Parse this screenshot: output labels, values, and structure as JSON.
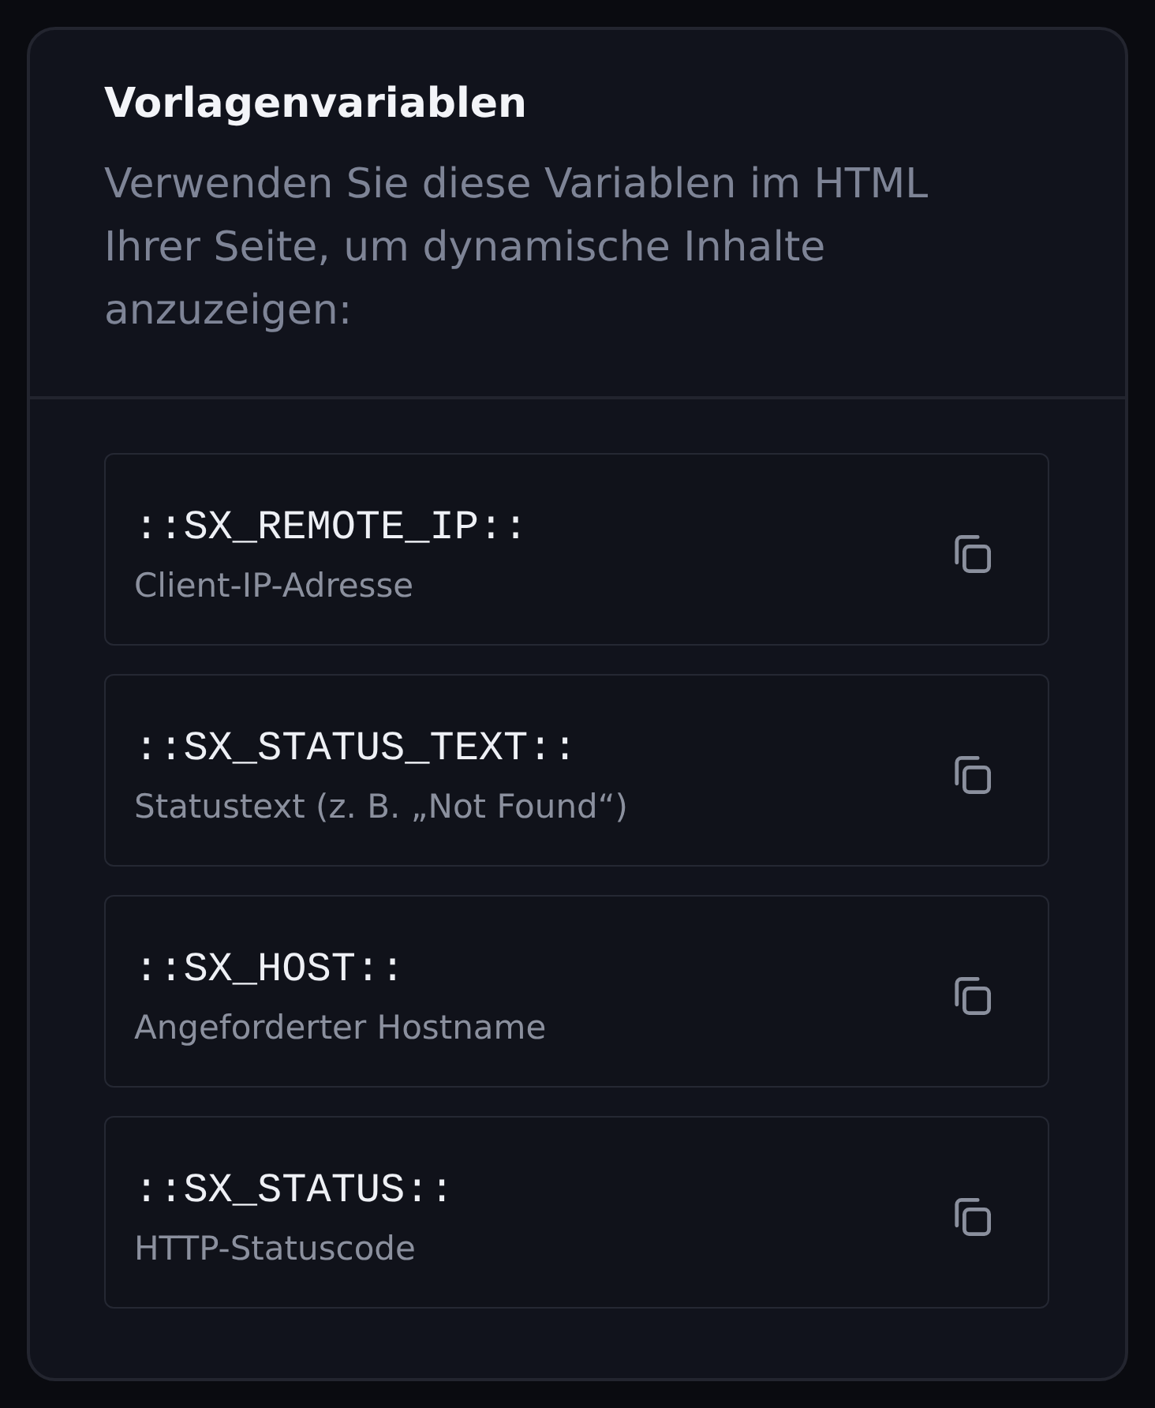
{
  "panel": {
    "title": "Vorlagenvariablen",
    "description": "Verwenden Sie diese Variablen im HTML Ihrer Seite, um dynamische Inhalte anzuzeigen:"
  },
  "variables": [
    {
      "name": "::SX_REMOTE_IP::",
      "description": "Client-IP-Adresse"
    },
    {
      "name": "::SX_STATUS_TEXT::",
      "description": "Statustext (z. B. „Not Found“)"
    },
    {
      "name": "::SX_HOST::",
      "description": "Angeforderter Hostname"
    },
    {
      "name": "::SX_STATUS::",
      "description": "HTTP-Statuscode"
    }
  ]
}
